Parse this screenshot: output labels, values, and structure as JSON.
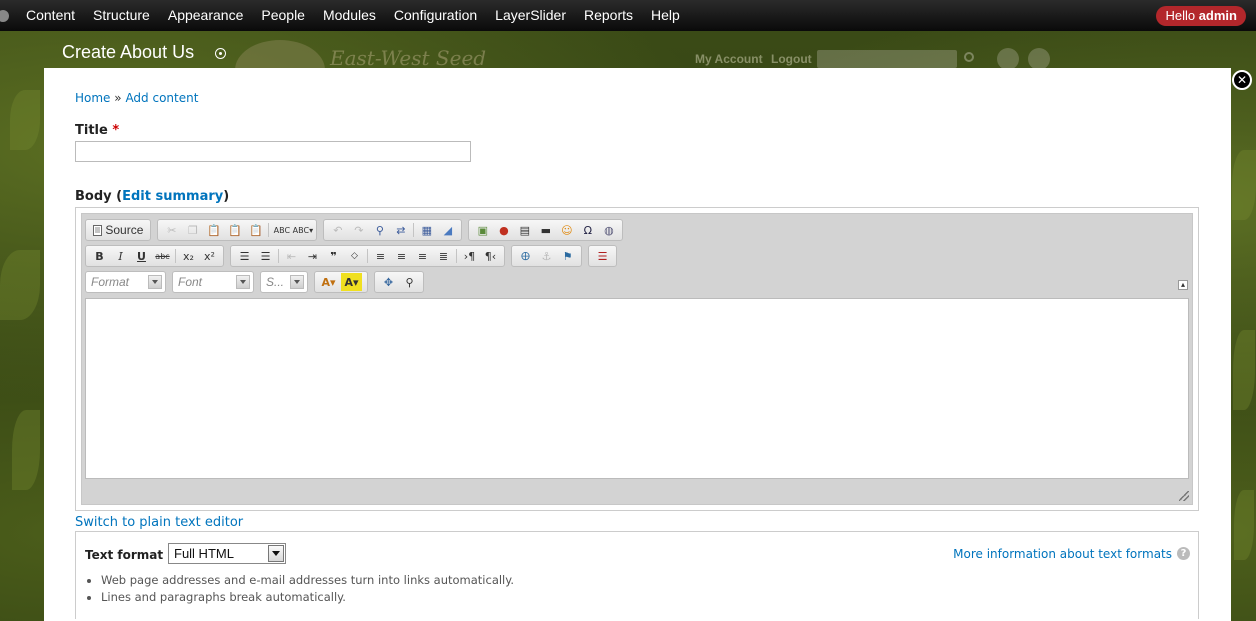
{
  "toolbar": {
    "items": [
      "Content",
      "Structure",
      "Appearance",
      "People",
      "Modules",
      "Configuration",
      "LayerSlider",
      "Reports",
      "Help"
    ],
    "hello_prefix": "Hello",
    "hello_user": "admin"
  },
  "site": {
    "logo_text": "East-West Seed",
    "account_link": "My Account",
    "logout_link": "Logout"
  },
  "overlay": {
    "title": "Create About Us",
    "close_glyph": "✕"
  },
  "breadcrumb": {
    "home": "Home",
    "separator": "»",
    "current": "Add content"
  },
  "form": {
    "title_label": "Title",
    "required_mark": "*",
    "title_value": "",
    "body_label": "Body",
    "body_paren_open": "(",
    "edit_summary": "Edit summary",
    "body_paren_close": ")"
  },
  "editor": {
    "source_label": "Source",
    "combos": {
      "format": "Format",
      "font": "Font",
      "size": "S..."
    },
    "toolbar_icons_row1": [
      "cut-icon",
      "copy-icon",
      "paste-icon",
      "paste-text-icon",
      "paste-word-icon",
      "spellcheck-icon",
      "scayt-icon",
      "undo-icon",
      "redo-icon",
      "find-icon",
      "replace-icon",
      "select-all-icon",
      "remove-format-icon",
      "image-icon",
      "flash-icon",
      "table-icon",
      "horizontal-rule-icon",
      "smiley-icon",
      "special-char-icon",
      "iframe-icon"
    ],
    "toolbar_icons_row2": [
      "bold-icon",
      "italic-icon",
      "underline-icon",
      "strike-icon",
      "subscript-icon",
      "superscript-icon",
      "numbered-list-icon",
      "bulleted-list-icon",
      "outdent-icon",
      "indent-icon",
      "blockquote-icon",
      "div-icon",
      "align-left-icon",
      "align-center-icon",
      "align-right-icon",
      "justify-icon",
      "ltr-icon",
      "rtl-icon",
      "link-icon",
      "unlink-icon",
      "anchor-icon",
      "page-break-icon"
    ],
    "collapse_glyph": "▴",
    "switch_link": "Switch to plain text editor"
  },
  "text_format": {
    "label": "Text format",
    "selected": "Full HTML",
    "more_info": "More information about text formats",
    "help_glyph": "?",
    "tips": [
      "Web page addresses and e-mail addresses turn into links automatically.",
      "Lines and paragraphs break automatically."
    ]
  }
}
